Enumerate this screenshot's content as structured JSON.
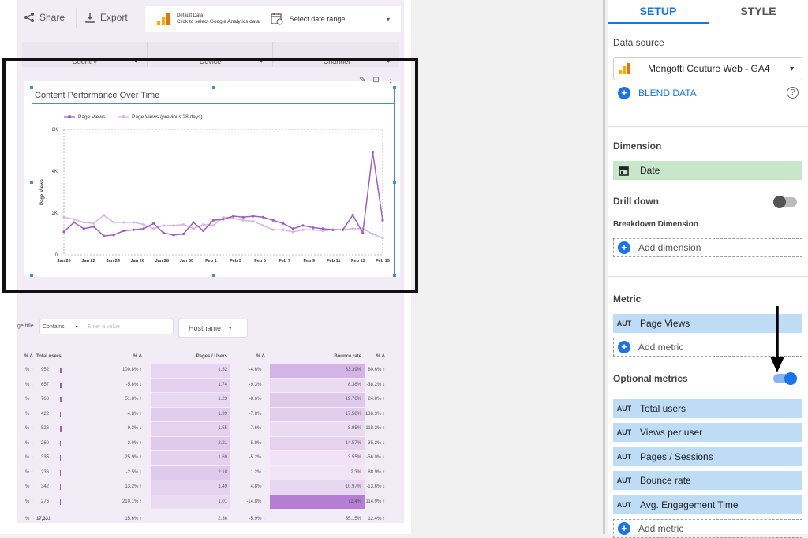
{
  "toolbar": {
    "share_label": "Share",
    "export_label": "Export"
  },
  "datasource_bar": {
    "title": "Default Data",
    "subtitle": "Click to select Google Analytics data",
    "date_label": "Select date range"
  },
  "controls": [
    {
      "label": "Country"
    },
    {
      "label": "Device"
    },
    {
      "label": "Channel"
    }
  ],
  "chart": {
    "title": "Content Performance Over Time"
  },
  "chart_data": {
    "type": "line",
    "title": "Content Performance Over Time",
    "ylabel": "Page Views",
    "ylim": [
      0,
      6000
    ],
    "yticks": [
      "0",
      "2K",
      "4K",
      "6K"
    ],
    "xticks": [
      "Jan 20",
      "Jan 22",
      "Jan 24",
      "Jan 26",
      "Jan 28",
      "Jan 30",
      "Feb 1",
      "Feb 3",
      "Feb 5",
      "Feb 7",
      "Feb 9",
      "Feb 11",
      "Feb 13",
      "Feb 15"
    ],
    "legend_position": "top-left",
    "series": [
      {
        "name": "Page Views",
        "color": "#9c5fbf",
        "values": [
          1100,
          1550,
          1250,
          1350,
          900,
          950,
          1150,
          1200,
          1250,
          1500,
          1050,
          950,
          1000,
          1550,
          1150,
          1650,
          1700,
          1850,
          1800,
          1850,
          1800,
          1650,
          1500,
          1250,
          1400,
          1300,
          1250,
          1200,
          1200,
          1900,
          1050,
          4900,
          1650
        ]
      },
      {
        "name": "Page Views (previous 28 days)",
        "color": "#d4b5e3",
        "values": [
          1800,
          1700,
          1550,
          1500,
          1900,
          1550,
          1550,
          1550,
          1450,
          1250,
          1400,
          1400,
          1450,
          1250,
          1450,
          1400,
          1800,
          1750,
          1650,
          1600,
          1400,
          1200,
          1200,
          1100,
          1200,
          1200,
          1150,
          1200,
          1200,
          1250,
          1250,
          1000,
          800
        ]
      }
    ]
  },
  "filter": {
    "field_label": "ge title",
    "operator": "Contains",
    "placeholder": "Enter a value",
    "hostname_label": "Hostname"
  },
  "table": {
    "headers": [
      "% Δ",
      "Total users",
      "% Δ",
      "Pages / Users",
      "% Δ",
      "Bounce rate",
      "% Δ"
    ],
    "rows": [
      [
        "% ↑",
        "952",
        "100.8% ↑",
        "1.32",
        "-4.6% ↓",
        "33.39%",
        "80.6% ↑"
      ],
      [
        "% ↓",
        "657",
        "-5.8% ↓",
        "1.74",
        "-9.3% ↓",
        "8.38%",
        "-38.2% ↓"
      ],
      [
        "% ↑",
        "768",
        "51.8% ↑",
        "1.23",
        "-8.6% ↓",
        "19.76%",
        "24.8% ↑"
      ],
      [
        "% ↑",
        "422",
        "4.8% ↑",
        "1.99",
        "-7.8% ↓",
        "17.58%",
        "136.3% ↑"
      ],
      [
        "% ↑",
        "526",
        "-9.3% ↓",
        "1.55",
        "7.6% ↑",
        "8.95%",
        "118.2% ↑"
      ],
      [
        "% ↓",
        "260",
        "2.0% ↑",
        "2.21",
        "-5.9% ↓",
        "14.57%",
        "-35.2% ↓"
      ],
      [
        "% ↑",
        "335",
        "25.9% ↑",
        "1.69",
        "-5.2% ↓",
        "3.55%",
        "-56.0% ↓"
      ],
      [
        "% ↑",
        "236",
        "-2.5% ↓",
        "2.18",
        "1.2% ↑",
        "2.3%",
        "88.9% ↑"
      ],
      [
        "% ↑",
        "342",
        "13.2% ↑",
        "1.49",
        "4.8% ↑",
        "10.97%",
        "-13.6% ↓"
      ],
      [
        "% ↑",
        "276",
        "210.1% ↑",
        "1.01",
        "-14.8% ↓",
        "72.4%",
        "114.9% ↑"
      ]
    ],
    "totals": [
      "% ↑",
      "17,331",
      "15.6% ↑",
      "2.36",
      "-5.9% ↓",
      "55.15%",
      "12.4% ↑"
    ]
  },
  "panel": {
    "tabs": [
      {
        "label": "SETUP"
      },
      {
        "label": "STYLE"
      }
    ],
    "data_source_label": "Data source",
    "data_source_value": "Mengotti Couture Web - GA4",
    "blend_label": "BLEND DATA",
    "dimension_label": "Dimension",
    "dimension_value": "Date",
    "drill_down_label": "Drill down",
    "breakdown_label": "Breakdown Dimension",
    "add_dimension_label": "Add dimension",
    "metric_label": "Metric",
    "metric_value": "Page Views",
    "add_metric_label": "Add metric",
    "optional_label": "Optional metrics",
    "aut": "AUT",
    "optional_metrics": [
      {
        "label": "Total users"
      },
      {
        "label": "Views per user"
      },
      {
        "label": "Pages / Sessions"
      },
      {
        "label": "Bounce rate"
      },
      {
        "label": "Avg. Engagement Time"
      }
    ],
    "add_metric_label_2": "Add metric"
  },
  "colors": {
    "accent": "#1a73e8",
    "dimension_chip": "#c8e6c9",
    "metric_chip": "#bfdcf7",
    "series_primary": "#9c5fbf",
    "series_previous": "#d4b5e3"
  }
}
